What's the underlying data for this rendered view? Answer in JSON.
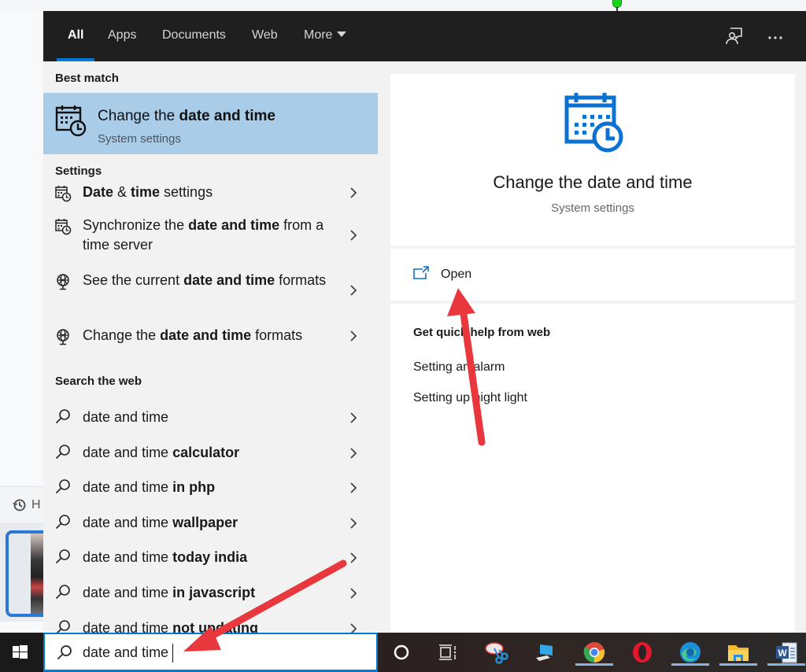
{
  "tabs": [
    {
      "label": "All",
      "active": true
    },
    {
      "label": "Apps"
    },
    {
      "label": "Documents"
    },
    {
      "label": "Web"
    },
    {
      "label": "More"
    }
  ],
  "top_icons": [
    "feedback-icon",
    "more-options-icon"
  ],
  "best_match": {
    "heading": "Best match",
    "title_prefix": "Change the ",
    "title_bold": "date and time",
    "subtitle": "System settings",
    "icon": "calendar-clock-icon"
  },
  "settings": {
    "heading": "Settings",
    "items": [
      {
        "icon": "calendar-clock-icon",
        "parts": [
          {
            "t": "Date",
            "b": true
          },
          {
            "t": " & "
          },
          {
            "t": "time",
            "b": true
          },
          {
            "t": " settings"
          }
        ]
      },
      {
        "icon": "calendar-clock-icon",
        "parts": [
          {
            "t": "Synchronize the "
          },
          {
            "t": "date and time",
            "b": true
          },
          {
            "t": " from a time server"
          }
        ]
      },
      {
        "icon": "globe-icon",
        "parts": [
          {
            "t": "See the current "
          },
          {
            "t": "date and time",
            "b": true
          },
          {
            "t": " formats"
          }
        ]
      },
      {
        "icon": "globe-icon",
        "parts": [
          {
            "t": "Change the "
          },
          {
            "t": "date and time",
            "b": true
          },
          {
            "t": " formats"
          }
        ]
      }
    ]
  },
  "web": {
    "heading": "Search the web",
    "items": [
      {
        "base": "date and time",
        "bold": ""
      },
      {
        "base": "date and time ",
        "bold": "calculator"
      },
      {
        "base": "date and time ",
        "bold": "in php"
      },
      {
        "base": "date and time ",
        "bold": "wallpaper"
      },
      {
        "base": "date and time ",
        "bold": "today india"
      },
      {
        "base": "date and time ",
        "bold": "in javascript"
      },
      {
        "base": "date and time ",
        "bold": "not updating"
      }
    ]
  },
  "search": {
    "value": "date and time",
    "icon": "search-icon"
  },
  "preview": {
    "title": "Change the date and time",
    "subtitle": "System settings",
    "open_label": "Open",
    "help_heading": "Get quick help from web",
    "help_links": [
      "Setting an alarm",
      "Setting up night light"
    ]
  },
  "background": {
    "history_label": "H"
  },
  "taskbar": {
    "items": [
      "cortana-icon",
      "task-view-icon",
      "snipping-tool-icon",
      "remote-desktop-icon",
      "chrome-icon",
      "opera-icon",
      "edge-icon",
      "file-explorer-icon",
      "word-icon"
    ]
  },
  "colors": {
    "accent": "#0078d4",
    "selection": "#a9cce8",
    "topbar": "#1f1f1f",
    "annotation_arrow": "#e8383d"
  }
}
